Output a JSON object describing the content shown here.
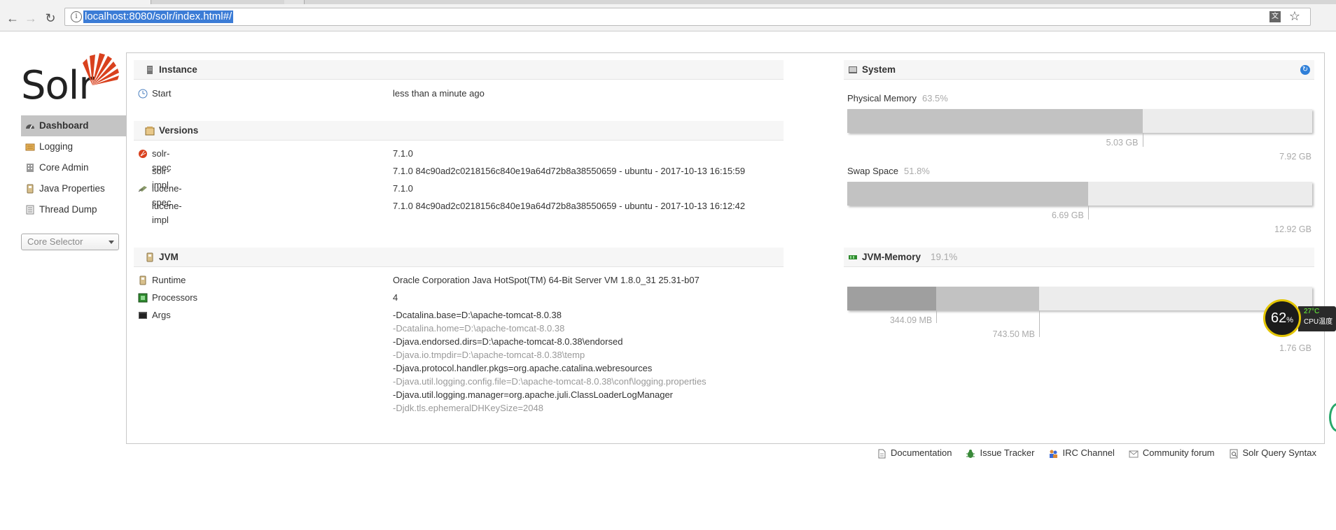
{
  "browser": {
    "url": "localhost:8080/solr/index.html#/",
    "info_glyph": "i"
  },
  "logo": {
    "text": "Solr"
  },
  "nav": {
    "items": [
      {
        "label": "Dashboard",
        "icon": "dashboard-icon",
        "active": true
      },
      {
        "label": "Logging",
        "icon": "logging-icon",
        "active": false
      },
      {
        "label": "Core Admin",
        "icon": "core-admin-icon",
        "active": false
      },
      {
        "label": "Java Properties",
        "icon": "java-properties-icon",
        "active": false
      },
      {
        "label": "Thread Dump",
        "icon": "thread-dump-icon",
        "active": false
      }
    ],
    "core_selector": "Core Selector"
  },
  "instance": {
    "title": "Instance",
    "start_label": "Start",
    "start_value": "less than a minute ago"
  },
  "versions": {
    "title": "Versions",
    "rows": [
      {
        "label": "solr-spec",
        "value": "7.1.0"
      },
      {
        "label": "solr-impl",
        "value": "7.1.0 84c90ad2c0218156c840e19a64d72b8a38550659 - ubuntu - 2017-10-13 16:15:59"
      },
      {
        "label": "lucene-spec",
        "value": "7.1.0"
      },
      {
        "label": "lucene-impl",
        "value": "7.1.0 84c90ad2c0218156c840e19a64d72b8a38550659 - ubuntu - 2017-10-13 16:12:42"
      }
    ]
  },
  "jvm": {
    "title": "JVM",
    "runtime_label": "Runtime",
    "runtime_value": "Oracle Corporation Java HotSpot(TM) 64-Bit Server VM 1.8.0_31 25.31-b07",
    "processors_label": "Processors",
    "processors_value": "4",
    "args_label": "Args",
    "args": [
      "-Dcatalina.base=D:\\apache-tomcat-8.0.38",
      "-Dcatalina.home=D:\\apache-tomcat-8.0.38",
      "-Djava.endorsed.dirs=D:\\apache-tomcat-8.0.38\\endorsed",
      "-Djava.io.tmpdir=D:\\apache-tomcat-8.0.38\\temp",
      "-Djava.protocol.handler.pkgs=org.apache.catalina.webresources",
      "-Djava.util.logging.config.file=D:\\apache-tomcat-8.0.38\\conf\\logging.properties",
      "-Djava.util.logging.manager=org.apache.juli.ClassLoaderLogManager",
      "-Djdk.tls.ephemeralDHKeySize=2048"
    ]
  },
  "system": {
    "title": "System",
    "physical": {
      "label": "Physical Memory",
      "pct": "63.5%",
      "used": "5.03 GB",
      "total": "7.92 GB",
      "fraction": 0.635
    },
    "swap": {
      "label": "Swap Space",
      "pct": "51.8%",
      "used": "6.69 GB",
      "total": "12.92 GB",
      "fraction": 0.518
    },
    "jvm_memory": {
      "label": "JVM-Memory",
      "pct": "19.1%",
      "used": "344.09 MB",
      "allocated": "743.50 MB",
      "max": "1.76 GB",
      "used_fraction": 0.191,
      "allocated_fraction": 0.412
    }
  },
  "footer": {
    "links": [
      {
        "label": "Documentation",
        "icon": "document-icon"
      },
      {
        "label": "Issue Tracker",
        "icon": "bug-icon"
      },
      {
        "label": "IRC Channel",
        "icon": "people-icon"
      },
      {
        "label": "Community forum",
        "icon": "mail-icon"
      },
      {
        "label": "Solr Query Syntax",
        "icon": "query-icon"
      }
    ]
  },
  "cpu_widget": {
    "value": "62",
    "unit": "%",
    "temp": "27°C",
    "label": "CPU温度"
  },
  "colors": {
    "active_nav": "#c4c4c4",
    "bar_used": "#c2c2c2",
    "bar_bg": "#ececec",
    "accent": "#2f7fd8"
  }
}
